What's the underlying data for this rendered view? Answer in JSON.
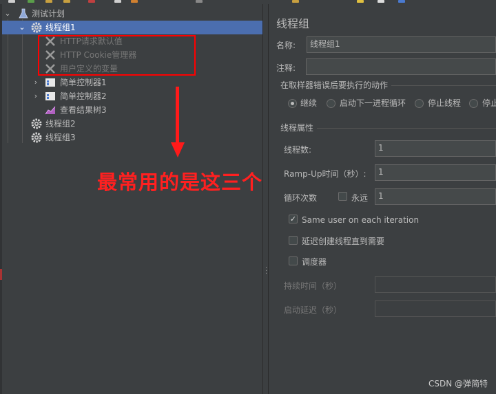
{
  "tree": {
    "test_plan": "测试计划",
    "thread_group_1": "线程组1",
    "http_defaults": "HTTP请求默认值",
    "cookie_manager": "HTTP Cookie管理器",
    "user_vars": "用户定义的变量",
    "simple_controller_1": "简单控制器1",
    "simple_controller_2": "简单控制器2",
    "view_results_tree": "查看结果树3",
    "thread_group_2": "线程组2",
    "thread_group_3": "线程组3"
  },
  "annotation": {
    "text": "最常用的是这三个",
    "color": "#ff2020"
  },
  "panel": {
    "title": "线程组",
    "name_label": "名称:",
    "name_value": "线程组1",
    "comment_label": "注释:",
    "comment_value": "",
    "error_action_section": "在取样器错误后要执行的动作",
    "error_actions": [
      "继续",
      "启动下一进程循环",
      "停止线程",
      "停止"
    ],
    "error_action_selected": "继续",
    "thread_props_section": "线程属性",
    "threads_label": "线程数:",
    "threads_value": "1",
    "rampup_label": "Ramp-Up时间（秒）:",
    "rampup_value": "1",
    "loop_label": "循环次数",
    "forever_label": "永远",
    "forever_checked": false,
    "loop_value": "1",
    "same_user_label": "Same user on each iteration",
    "same_user_checked": true,
    "delay_create_label": "延迟创建线程直到需要",
    "delay_create_checked": false,
    "scheduler_label": "调度器",
    "scheduler_checked": false,
    "duration_label": "持续时间（秒）",
    "startup_delay_label": "启动延迟（秒）"
  },
  "watermark": "CSDN @弹简特",
  "colors": {
    "selection": "#4b6eaf",
    "background": "#3c3f41",
    "highlight_box": "#ff0000"
  }
}
